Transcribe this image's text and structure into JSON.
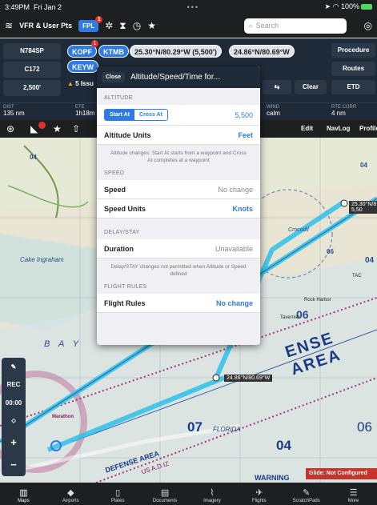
{
  "status_bar": {
    "time": "3:49PM",
    "date": "Fri Jan 2",
    "dots": "•••",
    "battery": "100%"
  },
  "toolbar": {
    "layers_label": "VFR & User Pts",
    "fpl_label": "FPL",
    "fpl_badge": "1",
    "search_placeholder": "Search"
  },
  "fpl": {
    "tail": "N784SP",
    "aircraft": "C172",
    "altitude": "2,500'",
    "issues": "5 Issu",
    "waypoints": [
      "KOPF",
      "KTMB",
      "25.30°N/80.29°W (5,500')",
      "24.86°N/80.69°W",
      "KEYW"
    ],
    "waypoint_badge": "1",
    "buttons": {
      "procedure": "Procedure",
      "routes": "Routes",
      "etd": "ETD",
      "clear": "Clear"
    }
  },
  "info": [
    {
      "label": "DIST",
      "value": "135 nm"
    },
    {
      "label": "ETE",
      "value": "1h18m"
    },
    {
      "label": "WIND",
      "value": "calm"
    },
    {
      "label": "RTE CORR",
      "value": "4 nm"
    }
  ],
  "map_tools": {
    "edit": "Edit",
    "navlog": "NavLog",
    "profile": "Profile"
  },
  "popover": {
    "close": "Close",
    "title": "Altitude/Speed/Time for...",
    "sections": {
      "altitude": "ALTITUDE",
      "speed": "SPEED",
      "delay": "DELAY/STAY",
      "flight_rules": "FLIGHT RULES"
    },
    "seg_start": "Start At",
    "seg_cross": "Cross At",
    "altitude_value": "5,500",
    "altitude_units_label": "Altitude Units",
    "altitude_units_value": "Feet",
    "altitude_note": "Altitude changes: Start At starts from a waypoint and Cross At completes at a waypoint",
    "speed_label": "Speed",
    "speed_value": "No change",
    "speed_units_label": "Speed Units",
    "speed_units_value": "Knots",
    "duration_label": "Duration",
    "duration_value": "Unavailable",
    "delay_note": "Delay/STAY changes not permitted when Altitude or Speed defined",
    "flight_rules_label": "Flight Rules",
    "flight_rules_value": "No change"
  },
  "map": {
    "labels": {
      "cake_ingraham": "Cake Ingraham",
      "bay": "B A Y",
      "dense_area": "ENSE AREA",
      "defense": "DEFENSE AREA",
      "us_adiz": "US A.D.IZ",
      "florida": "FLORIDA",
      "crocodile": "Crocodil",
      "marathon": "Marathon",
      "warning": "WARNING",
      "tac": "TAC",
      "rock_harbor": "Rock Harbor",
      "tavernier": "Tavernier",
      "wp1": "25.30°N/8",
      "wp1b": "5,50",
      "wp2": "24.86°N/80.69°W",
      "n04a": "04",
      "n04b": "04",
      "n06a": "06",
      "n04c": "04",
      "n07": "07",
      "n04d": "04",
      "n06b": "06",
      "n06c": "06"
    },
    "left_controls": {
      "rec": "REC",
      "timer": "00:00"
    },
    "glide": "Glide: Not Configured"
  },
  "tabs": [
    "Maps",
    "Airports",
    "Plates",
    "Documents",
    "Imagery",
    "Flights",
    "ScratchPads",
    "More"
  ],
  "colors": {
    "accent": "#2e7be6",
    "toolbar": "#1d1f21",
    "panel": "#1f2a38",
    "route": "#2ec1ea",
    "alert": "#e0312b"
  }
}
